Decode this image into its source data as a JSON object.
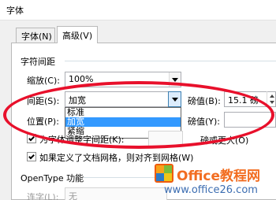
{
  "window": {
    "title": "字体"
  },
  "tabs": [
    {
      "label": "字体(N)",
      "active": false
    },
    {
      "label": "高级(V)",
      "active": true
    }
  ],
  "char_spacing": {
    "group_label": "字符间距",
    "scale": {
      "label": "缩放(C):",
      "value": "100%"
    },
    "spacing": {
      "label": "间距(S):",
      "value": "加宽",
      "by_label": "磅值(B):",
      "by_value": "15.1 磅"
    },
    "position": {
      "label": "位置(P):",
      "by_label": "磅值(Y):",
      "by_value": ""
    },
    "dropdown_options": [
      "标准",
      "加宽",
      "紧缩"
    ],
    "dropdown_selected": "加宽",
    "kerning": {
      "label": "为字体调整字间距(K):",
      "suffix": "磅或更大(O)",
      "checked": true
    },
    "snap_grid": {
      "label": "如果定义了文档网格，则对齐到网格(W)",
      "checked": true
    }
  },
  "opentype": {
    "group_label": "OpenType 功能",
    "ligatures": {
      "label": "连字(L):",
      "value": "无"
    }
  },
  "watermark": {
    "title": "Office教程网",
    "url": "www.office26.com"
  },
  "colors": {
    "accent": "#3399ff",
    "annotation": "#e8102b",
    "wm_orange": "#f26d21",
    "wm_blue": "#3c6db1"
  }
}
